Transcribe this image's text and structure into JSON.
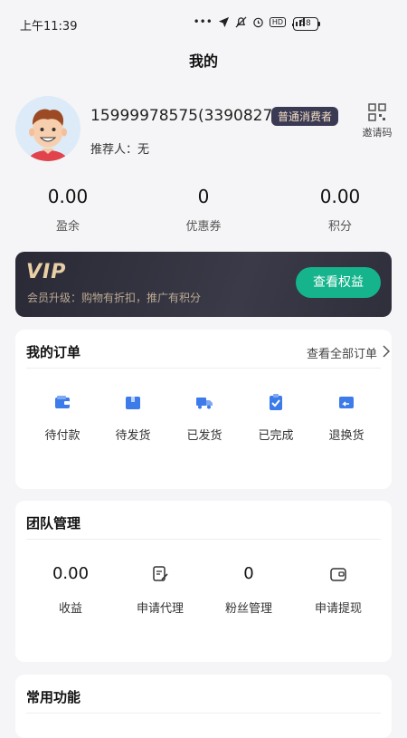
{
  "status_bar": {
    "time": "上午11:39",
    "battery": "58",
    "net_label": "HD"
  },
  "page": {
    "title": "我的"
  },
  "profile": {
    "phone_id": "15999978575(3390827)",
    "badge": "普通消费者",
    "referrer": "推荐人：无",
    "invite_label": "邀请码"
  },
  "stats": [
    {
      "value": "0.00",
      "label": "盈余"
    },
    {
      "value": "0",
      "label": "优惠券"
    },
    {
      "value": "0.00",
      "label": "积分"
    }
  ],
  "vip": {
    "logo": "VIP",
    "desc": "会员升级：购物有折扣，推广有积分",
    "button": "查看权益"
  },
  "orders": {
    "title": "我的订单",
    "view_all": "查看全部订单",
    "items": [
      {
        "label": "待付款",
        "icon": "wallet-icon"
      },
      {
        "label": "待发货",
        "icon": "package-icon"
      },
      {
        "label": "已发货",
        "icon": "truck-icon"
      },
      {
        "label": "已完成",
        "icon": "clipboard-check-icon"
      },
      {
        "label": "退换货",
        "icon": "return-icon"
      }
    ]
  },
  "team": {
    "title": "团队管理",
    "items": [
      {
        "value": "0.00",
        "label": "收益"
      },
      {
        "label": "申请代理",
        "icon": "edit-document-icon"
      },
      {
        "value": "0",
        "label": "粉丝管理"
      },
      {
        "label": "申请提现",
        "icon": "wallet-outline-icon"
      }
    ]
  },
  "functions": {
    "title": "常用功能"
  },
  "colors": {
    "accent_green": "#15b48c",
    "order_icon_blue": "#3d7bea",
    "vip_gold": "#e8cfa6"
  }
}
